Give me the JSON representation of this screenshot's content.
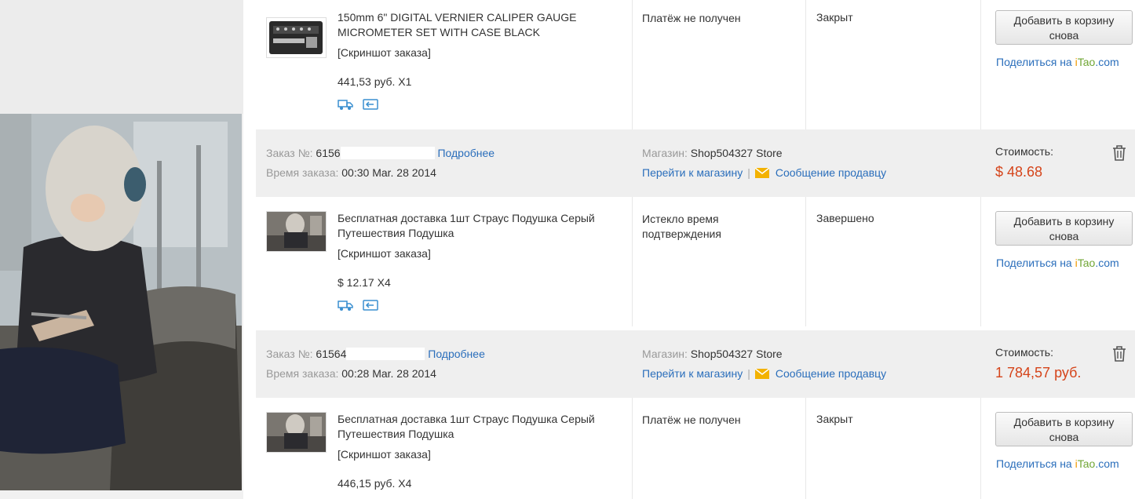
{
  "icons": {
    "delivery": "delivery-truck-icon",
    "dispute": "dispute-return-icon",
    "trash": "trash-icon",
    "mail": "envelope-icon"
  },
  "colors": {
    "link": "#2a6ebb",
    "price": "#d5441a",
    "header_bg": "#efefef"
  },
  "share": {
    "prefix": "Поделиться на ",
    "brand_i": "i",
    "brand_tao": "Tao",
    "brand_suffix": ".com"
  },
  "items": [
    {
      "title": "150mm 6\" DIGITAL VERNIER CALIPER GAUGE MICROMETER SET WITH CASE BLACK",
      "snapshot": "[Скриншот заказа]",
      "price": "441,53 руб. X1",
      "status": "Платёж не получен",
      "state": "Закрыт",
      "add_button": "Добавить в корзину снова"
    },
    {
      "title": "Бесплатная доставка 1шт Страус Подушка Серый Путешествия Подушка",
      "snapshot": "[Скриншот заказа]",
      "price": "$ 12.17 X4",
      "status": "Истекло время подтверждения",
      "state": "Завершено",
      "add_button": "Добавить в корзину снова"
    },
    {
      "title": "Бесплатная доставка 1шт Страус Подушка Серый Путешествия Подушка",
      "snapshot": "[Скриншот заказа]",
      "price": "446,15 руб. X4",
      "status": "Платёж не получен",
      "state": "Закрыт",
      "add_button": "Добавить в корзину снова"
    }
  ],
  "orders": [
    {
      "order_label": "Заказ №:",
      "order_number": "6156",
      "details_link": "Подробнее",
      "time_label": "Время заказа:",
      "time_value": "00:30 Mar. 28 2014",
      "store_label": "Магазин:",
      "store_name": "Shop504327 Store",
      "store_link": "Перейти к магазину",
      "message_link": "Сообщение продавцу",
      "cost_label": "Стоимость:",
      "cost_value": "$ 48.68"
    },
    {
      "order_label": "Заказ №:",
      "order_number": "61564",
      "details_link": "Подробнее",
      "time_label": "Время заказа:",
      "time_value": "00:28 Mar. 28 2014",
      "store_label": "Магазин:",
      "store_name": "Shop504327 Store",
      "store_link": "Перейти к магазину",
      "message_link": "Сообщение продавцу",
      "cost_label": "Стоимость:",
      "cost_value": "1 784,57 руб."
    }
  ]
}
